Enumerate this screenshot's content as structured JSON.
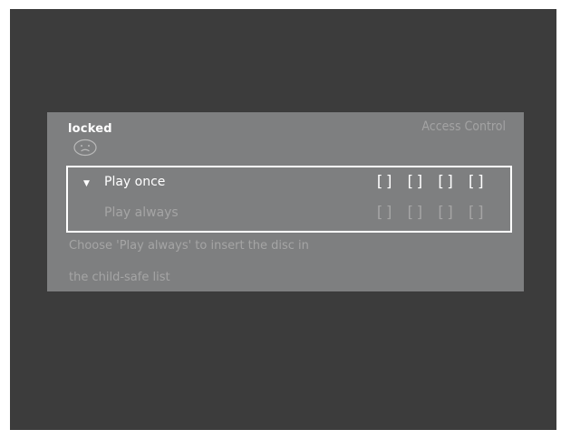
{
  "dialog": {
    "status": "locked",
    "title": "Access Control",
    "status_icon": "sad-face-icon"
  },
  "options": [
    {
      "label": "Play once",
      "code": "[] [] [] []",
      "selected": true
    },
    {
      "label": "Play always",
      "code": "[] [] [] []",
      "selected": false
    }
  ],
  "hint": {
    "line1": "Choose 'Play always' to insert the disc in",
    "line2": "the child-safe list"
  },
  "colors": {
    "background": "#3c3c3c",
    "panel": "#7e7f80",
    "active_text": "#ffffff",
    "inactive_text": "#a5a5a5"
  }
}
